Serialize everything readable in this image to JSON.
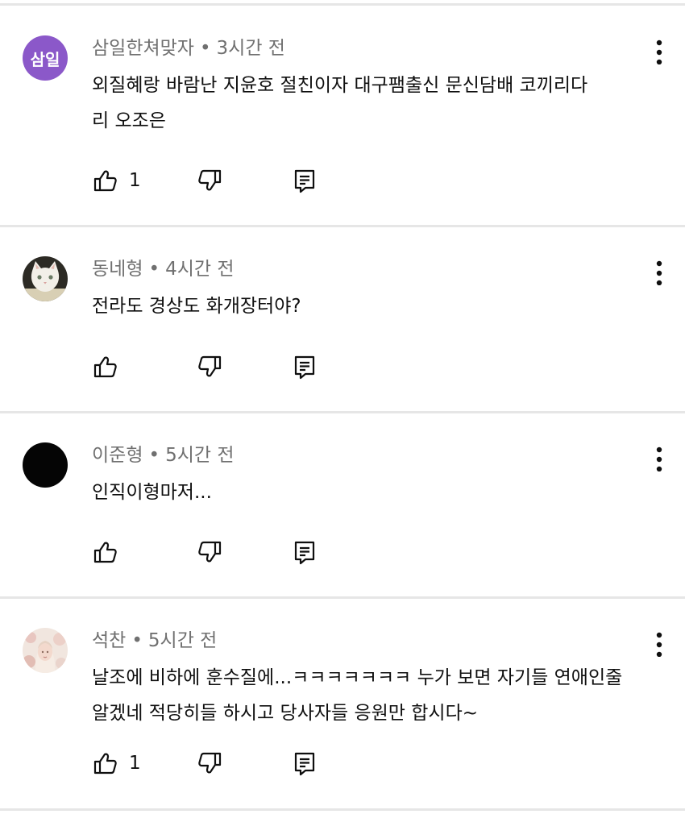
{
  "comments": [
    {
      "author": "삼일한쳐맞자",
      "time": "3시간 전",
      "avatar": {
        "type": "text",
        "text": "삼일",
        "color": "#8b58c9"
      },
      "lines": [
        "외질혜랑 바람난 지윤호 절친이자 대구팸출신 문신담배  코끼리다",
        "리 오조은"
      ],
      "likes": "1"
    },
    {
      "author": "동네형",
      "time": "4시간 전",
      "avatar": {
        "type": "image",
        "subject": "white-cat-photo"
      },
      "lines": [
        "전라도 경상도 화개장터야?"
      ],
      "likes": ""
    },
    {
      "author": "이준형",
      "time": "5시간 전",
      "avatar": {
        "type": "solid",
        "color": "#050505"
      },
      "lines": [
        "인직이형마저..."
      ],
      "likes": ""
    },
    {
      "author": "석찬",
      "time": "5시간 전",
      "avatar": {
        "type": "image",
        "subject": "person-with-flowers-photo"
      },
      "lines": [
        "날조에 비하에 훈수질에...ㅋㅋㅋㅋㅋㅋㅋ 누가 보면 자기들 연애인줄",
        "알겠네 적당히들 하시고 당사자들 응원만 합시다~"
      ],
      "likes": "1"
    }
  ],
  "separator": "•",
  "icons": {
    "like": "thumbs-up-icon",
    "dislike": "thumbs-down-icon",
    "reply": "reply-icon",
    "menu": "more-vert-icon"
  }
}
